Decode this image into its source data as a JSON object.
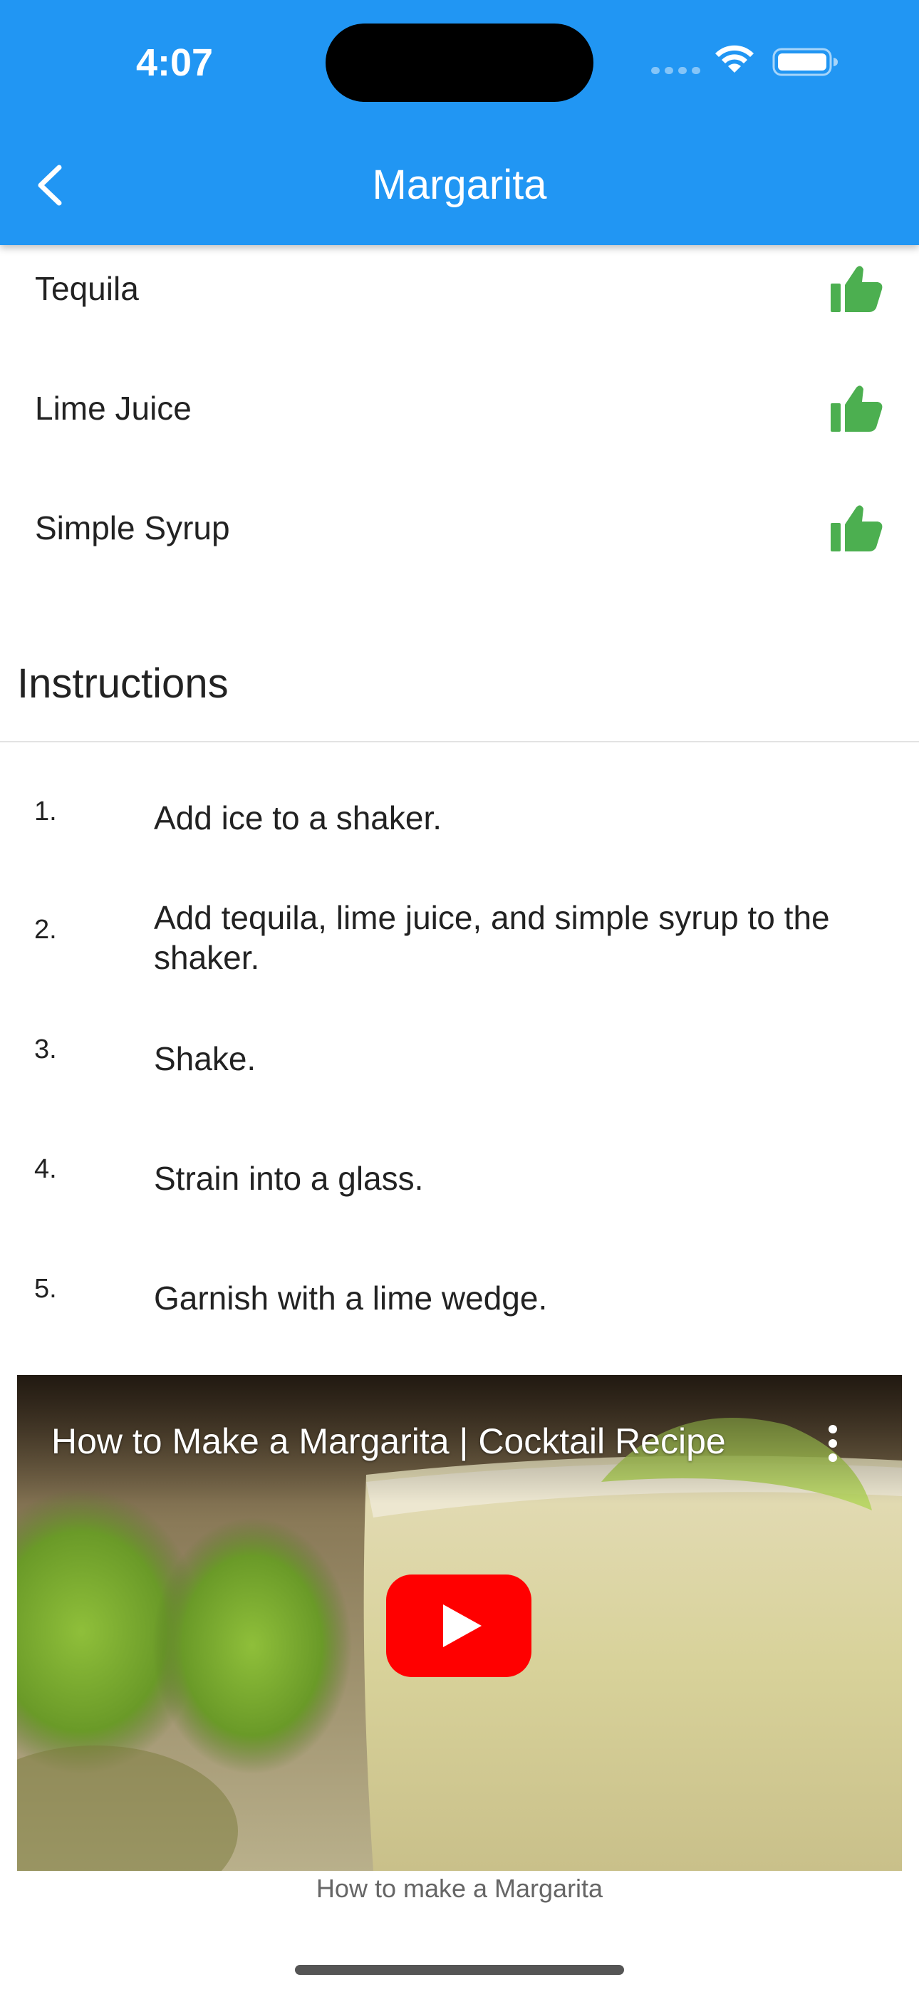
{
  "status_bar": {
    "time": "4:07"
  },
  "appbar": {
    "title": "Margarita",
    "background_color": "#2196F3",
    "back_icon": "chevron-left-icon"
  },
  "ingredients": [
    {
      "name": "Tequila",
      "icon": "thumbs-up-icon"
    },
    {
      "name": "Lime Juice",
      "icon": "thumbs-up-icon"
    },
    {
      "name": "Simple Syrup",
      "icon": "thumbs-up-icon"
    }
  ],
  "ingredient_icon_color": "#4CAF50",
  "instructions": {
    "heading": "Instructions",
    "steps": [
      {
        "number": "1.",
        "text": "Add ice to a shaker."
      },
      {
        "number": "2.",
        "text": "Add tequila, lime juice, and simple syrup to the shaker."
      },
      {
        "number": "3.",
        "text": "Shake."
      },
      {
        "number": "4.",
        "text": "Strain into a glass."
      },
      {
        "number": "5.",
        "text": "Garnish with a lime wedge."
      }
    ]
  },
  "video": {
    "title": "How to Make a Margarita | Cocktail Recipe",
    "caption": "How to make a Margarita",
    "play_icon": "youtube-play-icon",
    "menu_icon": "more-vertical-icon",
    "play_color": "#FF0000"
  }
}
